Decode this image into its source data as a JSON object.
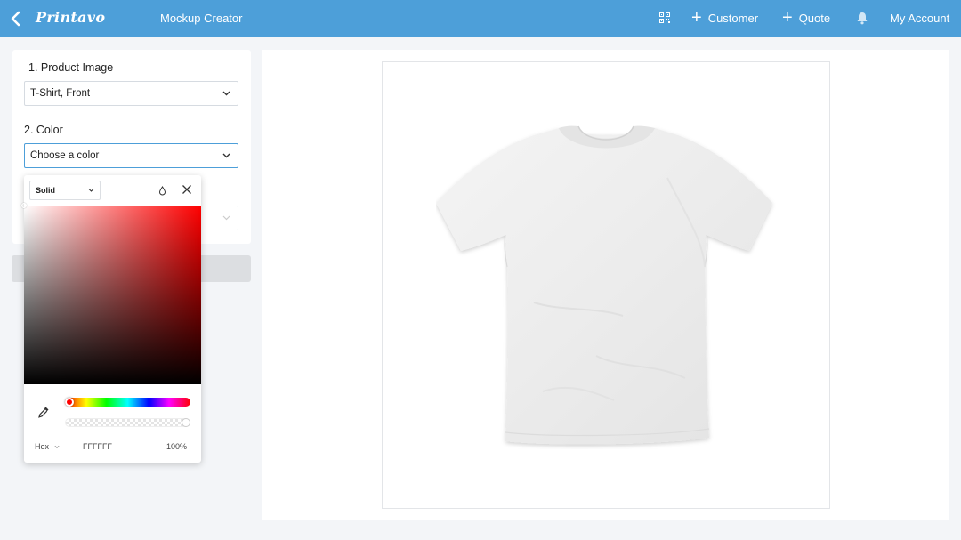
{
  "topbar": {
    "logo": "Printavo",
    "title": "Mockup Creator",
    "links": [
      {
        "label": "Customer",
        "icon": "plus-icon"
      },
      {
        "label": "Quote",
        "icon": "plus-icon"
      }
    ],
    "account": "My Account",
    "icons": [
      "back-arrow-icon",
      "qr-code-icon",
      "bell-icon"
    ],
    "color": "#4d9fd9"
  },
  "leftpanel": {
    "product_label": "1. Product Image",
    "product_value": "T-Shirt, Front",
    "color_label": "2. Color",
    "color_value": "Choose a color"
  },
  "picker": {
    "mode": "Solid",
    "format": "Hex",
    "hex": "FFFFFF",
    "opacity": "100%",
    "hue_color": "#ff0000",
    "icons": [
      "eyedropper-icon",
      "drop-icon",
      "close-icon"
    ]
  },
  "canvas": {
    "product": "t-shirt-front",
    "shirt_color": "#ffffff"
  }
}
